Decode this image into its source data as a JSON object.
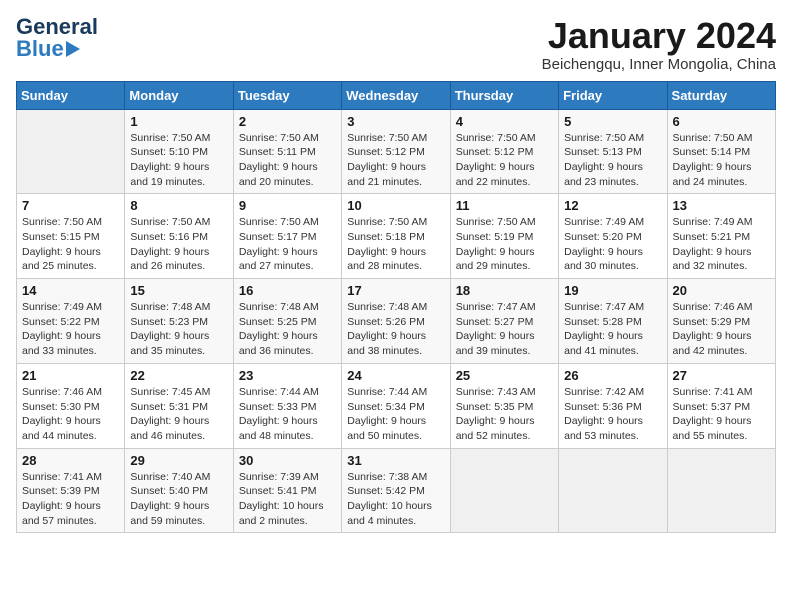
{
  "logo": {
    "text_general": "General",
    "text_blue": "Blue"
  },
  "title": "January 2024",
  "subtitle": "Beichengqu, Inner Mongolia, China",
  "days_header": [
    "Sunday",
    "Monday",
    "Tuesday",
    "Wednesday",
    "Thursday",
    "Friday",
    "Saturday"
  ],
  "weeks": [
    [
      {
        "day": "",
        "info": ""
      },
      {
        "day": "1",
        "info": "Sunrise: 7:50 AM\nSunset: 5:10 PM\nDaylight: 9 hours\nand 19 minutes."
      },
      {
        "day": "2",
        "info": "Sunrise: 7:50 AM\nSunset: 5:11 PM\nDaylight: 9 hours\nand 20 minutes."
      },
      {
        "day": "3",
        "info": "Sunrise: 7:50 AM\nSunset: 5:12 PM\nDaylight: 9 hours\nand 21 minutes."
      },
      {
        "day": "4",
        "info": "Sunrise: 7:50 AM\nSunset: 5:12 PM\nDaylight: 9 hours\nand 22 minutes."
      },
      {
        "day": "5",
        "info": "Sunrise: 7:50 AM\nSunset: 5:13 PM\nDaylight: 9 hours\nand 23 minutes."
      },
      {
        "day": "6",
        "info": "Sunrise: 7:50 AM\nSunset: 5:14 PM\nDaylight: 9 hours\nand 24 minutes."
      }
    ],
    [
      {
        "day": "7",
        "info": "Sunrise: 7:50 AM\nSunset: 5:15 PM\nDaylight: 9 hours\nand 25 minutes."
      },
      {
        "day": "8",
        "info": "Sunrise: 7:50 AM\nSunset: 5:16 PM\nDaylight: 9 hours\nand 26 minutes."
      },
      {
        "day": "9",
        "info": "Sunrise: 7:50 AM\nSunset: 5:17 PM\nDaylight: 9 hours\nand 27 minutes."
      },
      {
        "day": "10",
        "info": "Sunrise: 7:50 AM\nSunset: 5:18 PM\nDaylight: 9 hours\nand 28 minutes."
      },
      {
        "day": "11",
        "info": "Sunrise: 7:50 AM\nSunset: 5:19 PM\nDaylight: 9 hours\nand 29 minutes."
      },
      {
        "day": "12",
        "info": "Sunrise: 7:49 AM\nSunset: 5:20 PM\nDaylight: 9 hours\nand 30 minutes."
      },
      {
        "day": "13",
        "info": "Sunrise: 7:49 AM\nSunset: 5:21 PM\nDaylight: 9 hours\nand 32 minutes."
      }
    ],
    [
      {
        "day": "14",
        "info": "Sunrise: 7:49 AM\nSunset: 5:22 PM\nDaylight: 9 hours\nand 33 minutes."
      },
      {
        "day": "15",
        "info": "Sunrise: 7:48 AM\nSunset: 5:23 PM\nDaylight: 9 hours\nand 35 minutes."
      },
      {
        "day": "16",
        "info": "Sunrise: 7:48 AM\nSunset: 5:25 PM\nDaylight: 9 hours\nand 36 minutes."
      },
      {
        "day": "17",
        "info": "Sunrise: 7:48 AM\nSunset: 5:26 PM\nDaylight: 9 hours\nand 38 minutes."
      },
      {
        "day": "18",
        "info": "Sunrise: 7:47 AM\nSunset: 5:27 PM\nDaylight: 9 hours\nand 39 minutes."
      },
      {
        "day": "19",
        "info": "Sunrise: 7:47 AM\nSunset: 5:28 PM\nDaylight: 9 hours\nand 41 minutes."
      },
      {
        "day": "20",
        "info": "Sunrise: 7:46 AM\nSunset: 5:29 PM\nDaylight: 9 hours\nand 42 minutes."
      }
    ],
    [
      {
        "day": "21",
        "info": "Sunrise: 7:46 AM\nSunset: 5:30 PM\nDaylight: 9 hours\nand 44 minutes."
      },
      {
        "day": "22",
        "info": "Sunrise: 7:45 AM\nSunset: 5:31 PM\nDaylight: 9 hours\nand 46 minutes."
      },
      {
        "day": "23",
        "info": "Sunrise: 7:44 AM\nSunset: 5:33 PM\nDaylight: 9 hours\nand 48 minutes."
      },
      {
        "day": "24",
        "info": "Sunrise: 7:44 AM\nSunset: 5:34 PM\nDaylight: 9 hours\nand 50 minutes."
      },
      {
        "day": "25",
        "info": "Sunrise: 7:43 AM\nSunset: 5:35 PM\nDaylight: 9 hours\nand 52 minutes."
      },
      {
        "day": "26",
        "info": "Sunrise: 7:42 AM\nSunset: 5:36 PM\nDaylight: 9 hours\nand 53 minutes."
      },
      {
        "day": "27",
        "info": "Sunrise: 7:41 AM\nSunset: 5:37 PM\nDaylight: 9 hours\nand 55 minutes."
      }
    ],
    [
      {
        "day": "28",
        "info": "Sunrise: 7:41 AM\nSunset: 5:39 PM\nDaylight: 9 hours\nand 57 minutes."
      },
      {
        "day": "29",
        "info": "Sunrise: 7:40 AM\nSunset: 5:40 PM\nDaylight: 9 hours\nand 59 minutes."
      },
      {
        "day": "30",
        "info": "Sunrise: 7:39 AM\nSunset: 5:41 PM\nDaylight: 10 hours\nand 2 minutes."
      },
      {
        "day": "31",
        "info": "Sunrise: 7:38 AM\nSunset: 5:42 PM\nDaylight: 10 hours\nand 4 minutes."
      },
      {
        "day": "",
        "info": ""
      },
      {
        "day": "",
        "info": ""
      },
      {
        "day": "",
        "info": ""
      }
    ]
  ]
}
